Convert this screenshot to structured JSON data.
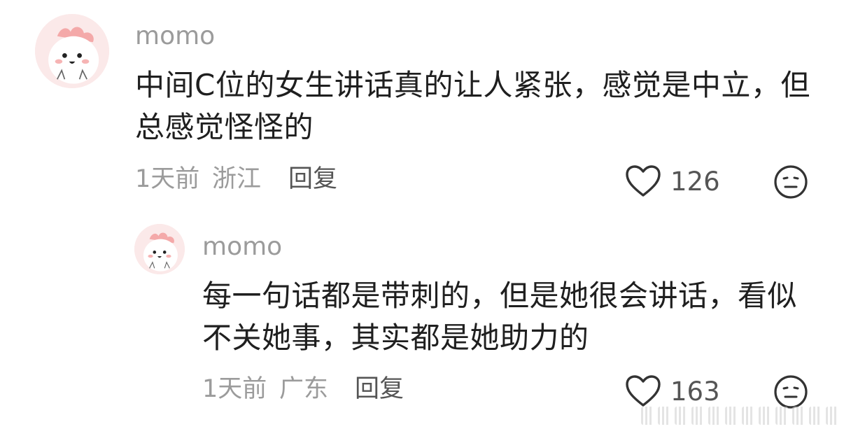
{
  "comments": [
    {
      "username": "momo",
      "text_line1": "中间C位的女生讲话真的让人紧张，感觉是中立，但",
      "text_line2": "总感觉怪怪的",
      "time": "1天前",
      "location": "浙江",
      "reply_label": "回复",
      "likes": "126",
      "avatar_icon": "cartoon-avatar-icon",
      "like_icon": "heart-outline-icon",
      "dislike_icon": "meh-face-icon"
    },
    {
      "username": "momo",
      "text_line1": "每一句话都是带刺的，但是她很会讲话，看似",
      "text_line2": "不关她事，其实都是她助力的",
      "time": "1天前",
      "location": "广东",
      "reply_label": "回复",
      "likes": "163",
      "avatar_icon": "cartoon-avatar-icon",
      "like_icon": "heart-outline-icon",
      "dislike_icon": "meh-face-icon"
    }
  ],
  "colors": {
    "username": "#9b9b9b",
    "text": "#1f1f1f",
    "meta": "#9b9b9b",
    "icon": "#333333",
    "avatar_bg": "#fbeaea"
  }
}
